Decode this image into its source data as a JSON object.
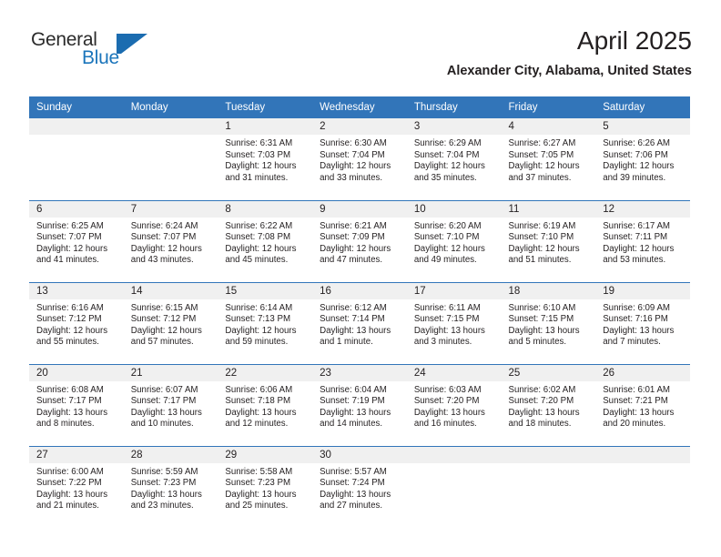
{
  "brand": {
    "word_one": "General",
    "word_two": "Blue",
    "mark": "flag-triangle-icon"
  },
  "header": {
    "title": "April 2025",
    "subtitle": "Alexander City, Alabama, United States"
  },
  "colors": {
    "header_blue": "#3275b9",
    "brand_blue": "#1b75bb",
    "daynum_band": "#f0f0f0",
    "text": "#231f20"
  },
  "weekday_headers": [
    "Sunday",
    "Monday",
    "Tuesday",
    "Wednesday",
    "Thursday",
    "Friday",
    "Saturday"
  ],
  "weeks": [
    [
      {
        "day": "",
        "blank": true
      },
      {
        "day": "",
        "blank": true
      },
      {
        "day": "1",
        "sunrise": "Sunrise: 6:31 AM",
        "sunset": "Sunset: 7:03 PM",
        "daylight_line1": "Daylight: 12 hours",
        "daylight_line2": "and 31 minutes."
      },
      {
        "day": "2",
        "sunrise": "Sunrise: 6:30 AM",
        "sunset": "Sunset: 7:04 PM",
        "daylight_line1": "Daylight: 12 hours",
        "daylight_line2": "and 33 minutes."
      },
      {
        "day": "3",
        "sunrise": "Sunrise: 6:29 AM",
        "sunset": "Sunset: 7:04 PM",
        "daylight_line1": "Daylight: 12 hours",
        "daylight_line2": "and 35 minutes."
      },
      {
        "day": "4",
        "sunrise": "Sunrise: 6:27 AM",
        "sunset": "Sunset: 7:05 PM",
        "daylight_line1": "Daylight: 12 hours",
        "daylight_line2": "and 37 minutes."
      },
      {
        "day": "5",
        "sunrise": "Sunrise: 6:26 AM",
        "sunset": "Sunset: 7:06 PM",
        "daylight_line1": "Daylight: 12 hours",
        "daylight_line2": "and 39 minutes."
      }
    ],
    [
      {
        "day": "6",
        "sunrise": "Sunrise: 6:25 AM",
        "sunset": "Sunset: 7:07 PM",
        "daylight_line1": "Daylight: 12 hours",
        "daylight_line2": "and 41 minutes."
      },
      {
        "day": "7",
        "sunrise": "Sunrise: 6:24 AM",
        "sunset": "Sunset: 7:07 PM",
        "daylight_line1": "Daylight: 12 hours",
        "daylight_line2": "and 43 minutes."
      },
      {
        "day": "8",
        "sunrise": "Sunrise: 6:22 AM",
        "sunset": "Sunset: 7:08 PM",
        "daylight_line1": "Daylight: 12 hours",
        "daylight_line2": "and 45 minutes."
      },
      {
        "day": "9",
        "sunrise": "Sunrise: 6:21 AM",
        "sunset": "Sunset: 7:09 PM",
        "daylight_line1": "Daylight: 12 hours",
        "daylight_line2": "and 47 minutes."
      },
      {
        "day": "10",
        "sunrise": "Sunrise: 6:20 AM",
        "sunset": "Sunset: 7:10 PM",
        "daylight_line1": "Daylight: 12 hours",
        "daylight_line2": "and 49 minutes."
      },
      {
        "day": "11",
        "sunrise": "Sunrise: 6:19 AM",
        "sunset": "Sunset: 7:10 PM",
        "daylight_line1": "Daylight: 12 hours",
        "daylight_line2": "and 51 minutes."
      },
      {
        "day": "12",
        "sunrise": "Sunrise: 6:17 AM",
        "sunset": "Sunset: 7:11 PM",
        "daylight_line1": "Daylight: 12 hours",
        "daylight_line2": "and 53 minutes."
      }
    ],
    [
      {
        "day": "13",
        "sunrise": "Sunrise: 6:16 AM",
        "sunset": "Sunset: 7:12 PM",
        "daylight_line1": "Daylight: 12 hours",
        "daylight_line2": "and 55 minutes."
      },
      {
        "day": "14",
        "sunrise": "Sunrise: 6:15 AM",
        "sunset": "Sunset: 7:12 PM",
        "daylight_line1": "Daylight: 12 hours",
        "daylight_line2": "and 57 minutes."
      },
      {
        "day": "15",
        "sunrise": "Sunrise: 6:14 AM",
        "sunset": "Sunset: 7:13 PM",
        "daylight_line1": "Daylight: 12 hours",
        "daylight_line2": "and 59 minutes."
      },
      {
        "day": "16",
        "sunrise": "Sunrise: 6:12 AM",
        "sunset": "Sunset: 7:14 PM",
        "daylight_line1": "Daylight: 13 hours",
        "daylight_line2": "and 1 minute."
      },
      {
        "day": "17",
        "sunrise": "Sunrise: 6:11 AM",
        "sunset": "Sunset: 7:15 PM",
        "daylight_line1": "Daylight: 13 hours",
        "daylight_line2": "and 3 minutes."
      },
      {
        "day": "18",
        "sunrise": "Sunrise: 6:10 AM",
        "sunset": "Sunset: 7:15 PM",
        "daylight_line1": "Daylight: 13 hours",
        "daylight_line2": "and 5 minutes."
      },
      {
        "day": "19",
        "sunrise": "Sunrise: 6:09 AM",
        "sunset": "Sunset: 7:16 PM",
        "daylight_line1": "Daylight: 13 hours",
        "daylight_line2": "and 7 minutes."
      }
    ],
    [
      {
        "day": "20",
        "sunrise": "Sunrise: 6:08 AM",
        "sunset": "Sunset: 7:17 PM",
        "daylight_line1": "Daylight: 13 hours",
        "daylight_line2": "and 8 minutes."
      },
      {
        "day": "21",
        "sunrise": "Sunrise: 6:07 AM",
        "sunset": "Sunset: 7:17 PM",
        "daylight_line1": "Daylight: 13 hours",
        "daylight_line2": "and 10 minutes."
      },
      {
        "day": "22",
        "sunrise": "Sunrise: 6:06 AM",
        "sunset": "Sunset: 7:18 PM",
        "daylight_line1": "Daylight: 13 hours",
        "daylight_line2": "and 12 minutes."
      },
      {
        "day": "23",
        "sunrise": "Sunrise: 6:04 AM",
        "sunset": "Sunset: 7:19 PM",
        "daylight_line1": "Daylight: 13 hours",
        "daylight_line2": "and 14 minutes."
      },
      {
        "day": "24",
        "sunrise": "Sunrise: 6:03 AM",
        "sunset": "Sunset: 7:20 PM",
        "daylight_line1": "Daylight: 13 hours",
        "daylight_line2": "and 16 minutes."
      },
      {
        "day": "25",
        "sunrise": "Sunrise: 6:02 AM",
        "sunset": "Sunset: 7:20 PM",
        "daylight_line1": "Daylight: 13 hours",
        "daylight_line2": "and 18 minutes."
      },
      {
        "day": "26",
        "sunrise": "Sunrise: 6:01 AM",
        "sunset": "Sunset: 7:21 PM",
        "daylight_line1": "Daylight: 13 hours",
        "daylight_line2": "and 20 minutes."
      }
    ],
    [
      {
        "day": "27",
        "sunrise": "Sunrise: 6:00 AM",
        "sunset": "Sunset: 7:22 PM",
        "daylight_line1": "Daylight: 13 hours",
        "daylight_line2": "and 21 minutes."
      },
      {
        "day": "28",
        "sunrise": "Sunrise: 5:59 AM",
        "sunset": "Sunset: 7:23 PM",
        "daylight_line1": "Daylight: 13 hours",
        "daylight_line2": "and 23 minutes."
      },
      {
        "day": "29",
        "sunrise": "Sunrise: 5:58 AM",
        "sunset": "Sunset: 7:23 PM",
        "daylight_line1": "Daylight: 13 hours",
        "daylight_line2": "and 25 minutes."
      },
      {
        "day": "30",
        "sunrise": "Sunrise: 5:57 AM",
        "sunset": "Sunset: 7:24 PM",
        "daylight_line1": "Daylight: 13 hours",
        "daylight_line2": "and 27 minutes."
      },
      {
        "day": "",
        "blank": true
      },
      {
        "day": "",
        "blank": true
      },
      {
        "day": "",
        "blank": true
      }
    ]
  ]
}
